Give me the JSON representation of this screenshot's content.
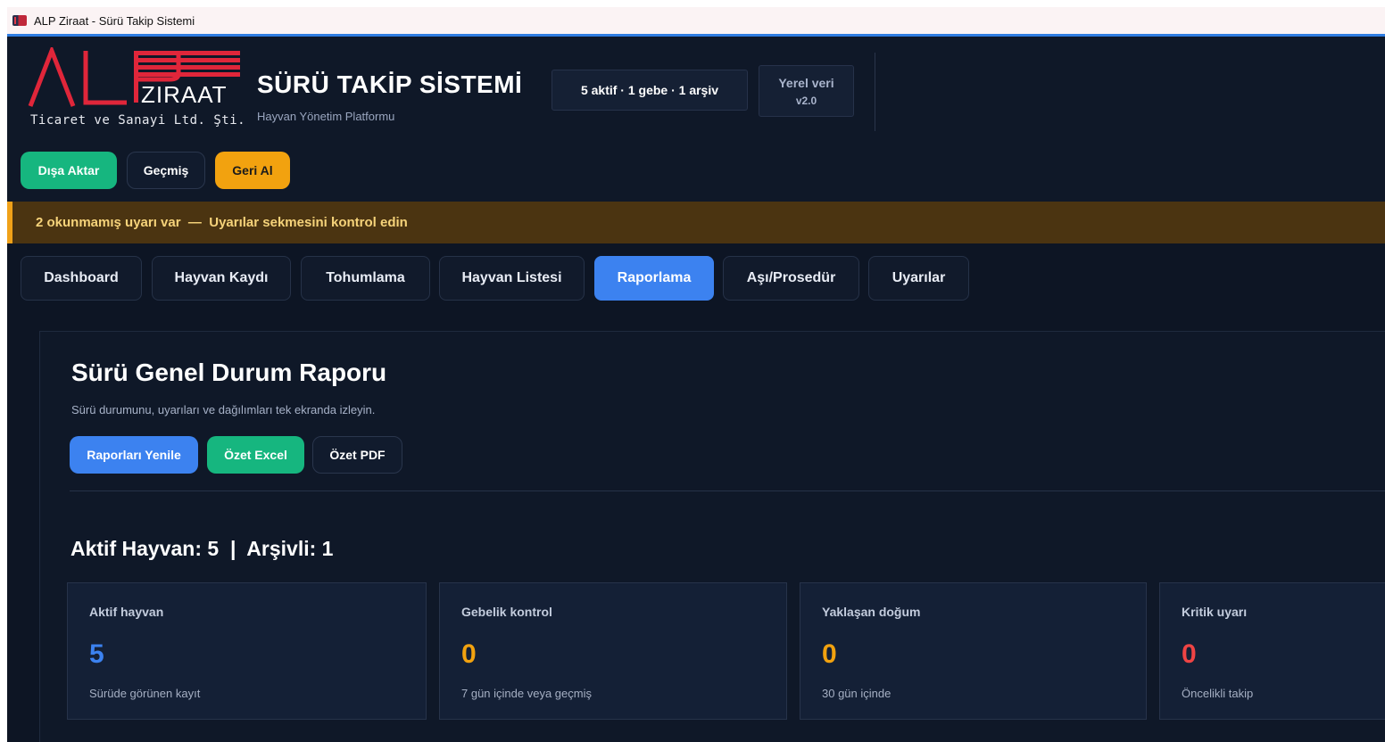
{
  "window": {
    "title": "ALP Ziraat - Sürü Takip Sistemi"
  },
  "brand": {
    "logo_text": "ALP",
    "logo_word": "ZIRAAT",
    "company": "Ticaret ve Sanayi Ltd. Şti.",
    "title": "SÜRÜ TAKİP SİSTEMİ",
    "subtitle": "Hayvan Yönetim Platformu",
    "logo_color": "#e0263a"
  },
  "status": {
    "summary": "5 aktif · 1 gebe · 1 arşiv",
    "data_mode": "Yerel veri",
    "version": "v2.0"
  },
  "toolbar": {
    "export_label": "Dışa Aktar",
    "history_label": "Geçmiş",
    "undo_label": "Geri Al"
  },
  "alert": {
    "text": "2 okunmamış uyarı var  —  Uyarılar sekmesini kontrol edin"
  },
  "tabs": [
    {
      "label": "Dashboard"
    },
    {
      "label": "Hayvan Kaydı"
    },
    {
      "label": "Tohumlama"
    },
    {
      "label": "Hayvan Listesi"
    },
    {
      "label": "Raporlama"
    },
    {
      "label": "Aşı/Prosedür"
    },
    {
      "label": "Uyarılar"
    }
  ],
  "active_tab": "Raporlama",
  "report": {
    "title": "Sürü Genel Durum Raporu",
    "description": "Sürü durumunu, uyarıları ve dağılımları tek ekranda izleyin.",
    "refresh_label": "Raporları Yenile",
    "excel_label": "Özet Excel",
    "pdf_label": "Özet PDF",
    "summary_line": "Aktif Hayvan: 5  |  Arşivli: 1",
    "cards": [
      {
        "label": "Aktif hayvan",
        "value": "5",
        "note": "Sürüde görünen kayıt",
        "color": "#3c82f0"
      },
      {
        "label": "Gebelik kontrol",
        "value": "0",
        "note": "7 gün içinde veya geçmiş",
        "color": "#f2a20f"
      },
      {
        "label": "Yaklaşan doğum",
        "value": "0",
        "note": "30 gün içinde",
        "color": "#f2a20f"
      },
      {
        "label": "Kritik uyarı",
        "value": "0",
        "note": "Öncelikli takip",
        "color": "#ef4444"
      }
    ]
  }
}
